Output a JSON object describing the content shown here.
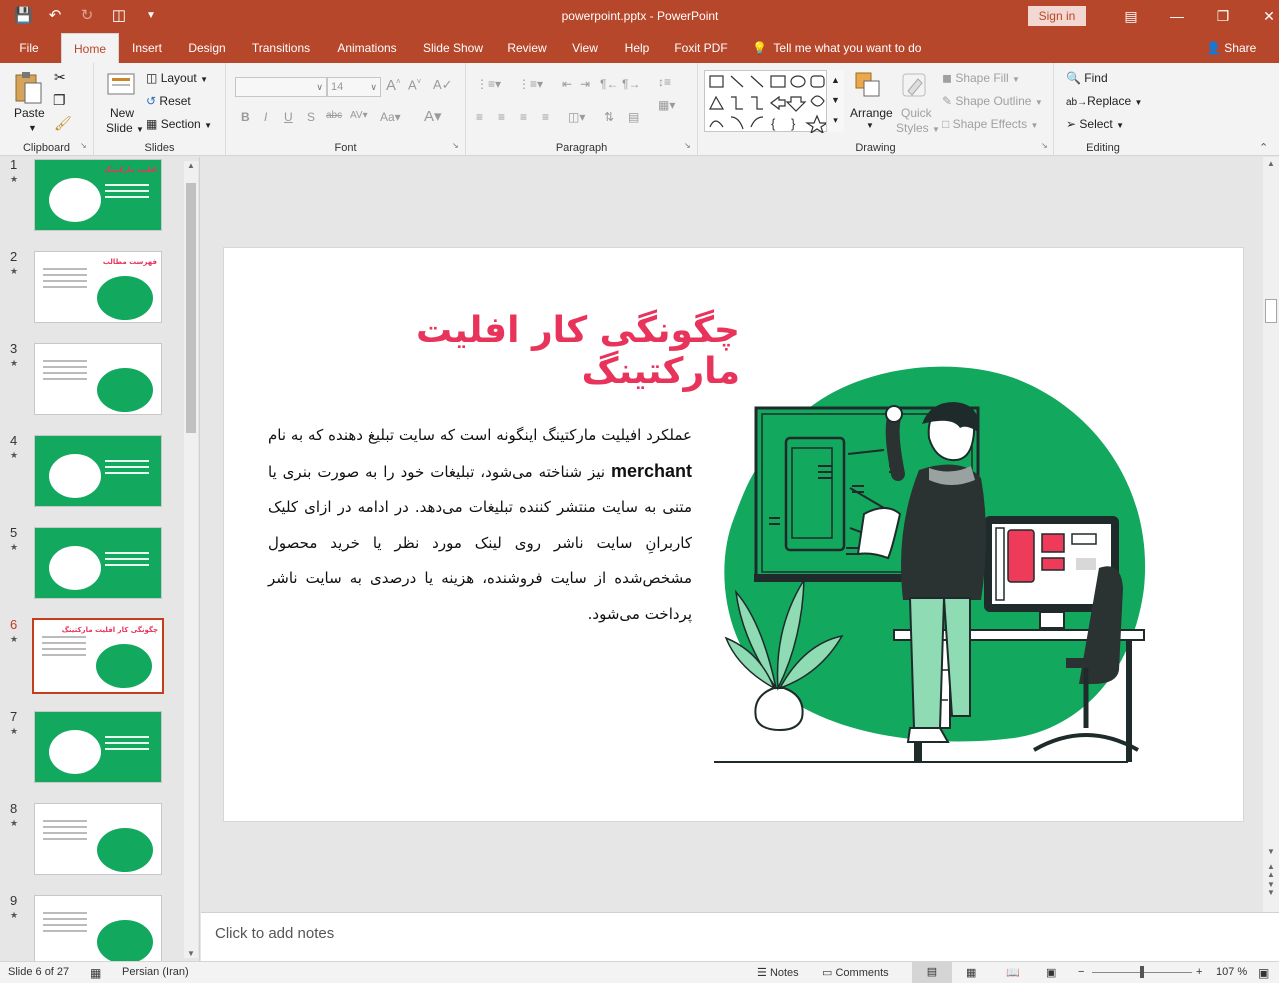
{
  "titlebar": {
    "doc_title": "powerpoint.pptx  -  PowerPoint",
    "signin": "Sign in"
  },
  "tabs": {
    "file": "File",
    "home": "Home",
    "insert": "Insert",
    "design": "Design",
    "transitions": "Transitions",
    "animations": "Animations",
    "slideshow": "Slide Show",
    "review": "Review",
    "view": "View",
    "help": "Help",
    "foxit": "Foxit PDF",
    "tell": "Tell me what you want to do",
    "share": "Share"
  },
  "ribbon": {
    "clipboard": {
      "label": "Clipboard",
      "paste": "Paste"
    },
    "slides": {
      "label": "Slides",
      "new_slide_1": "New",
      "new_slide_2": "Slide",
      "layout": "Layout",
      "reset": "Reset",
      "section": "Section"
    },
    "font": {
      "label": "Font",
      "size": "14"
    },
    "paragraph": {
      "label": "Paragraph"
    },
    "drawing": {
      "label": "Drawing",
      "arrange": "Arrange",
      "quick_styles_1": "Quick",
      "quick_styles_2": "Styles",
      "shape_fill": "Shape Fill",
      "shape_outline": "Shape Outline",
      "shape_effects": "Shape Effects"
    },
    "editing": {
      "label": "Editing",
      "find": "Find",
      "replace": "Replace",
      "select": "Select"
    }
  },
  "thumbnails": [
    {
      "num": "1",
      "title": "افلیت مارکتینگ"
    },
    {
      "num": "2",
      "title": "فهرست مطالب"
    },
    {
      "num": "3",
      "title": ""
    },
    {
      "num": "4",
      "title": ""
    },
    {
      "num": "5",
      "title": ""
    },
    {
      "num": "6",
      "title": "چگونگی کار افلیت مارکتینگ"
    },
    {
      "num": "7",
      "title": ""
    },
    {
      "num": "8",
      "title": ""
    },
    {
      "num": "9",
      "title": ""
    }
  ],
  "slide": {
    "title": "چگونگی کار افلیت مارکتینگ",
    "body_1": "عملکرد افیلیت مارکتینگ اینگونه است که  سایت تبلیغ دهنده که به نام ",
    "body_bold": "merchant",
    "body_2": " نیز شناخته می‌شود، تبلیغات خود را به صورت بنری یا متنی به سایت منتشر کننده تبلیغات می‌دهد. در ادامه در ازای کلیک کاربرانِ سایت ناشر روی لینک مورد نظر یا خرید محصول مشخص‌شده از سایت فروشنده، هزینه یا درصدی به سایت ناشر پرداخت می‌شود."
  },
  "notes": {
    "placeholder": "Click to add notes"
  },
  "status": {
    "slide_count": "Slide 6 of 27",
    "language": "Persian (Iran)",
    "notes": "Notes",
    "comments": "Comments",
    "zoom": "107 %"
  },
  "colors": {
    "accent": "#b7472a",
    "title_pink": "#e8335a",
    "green": "#12a85e"
  }
}
